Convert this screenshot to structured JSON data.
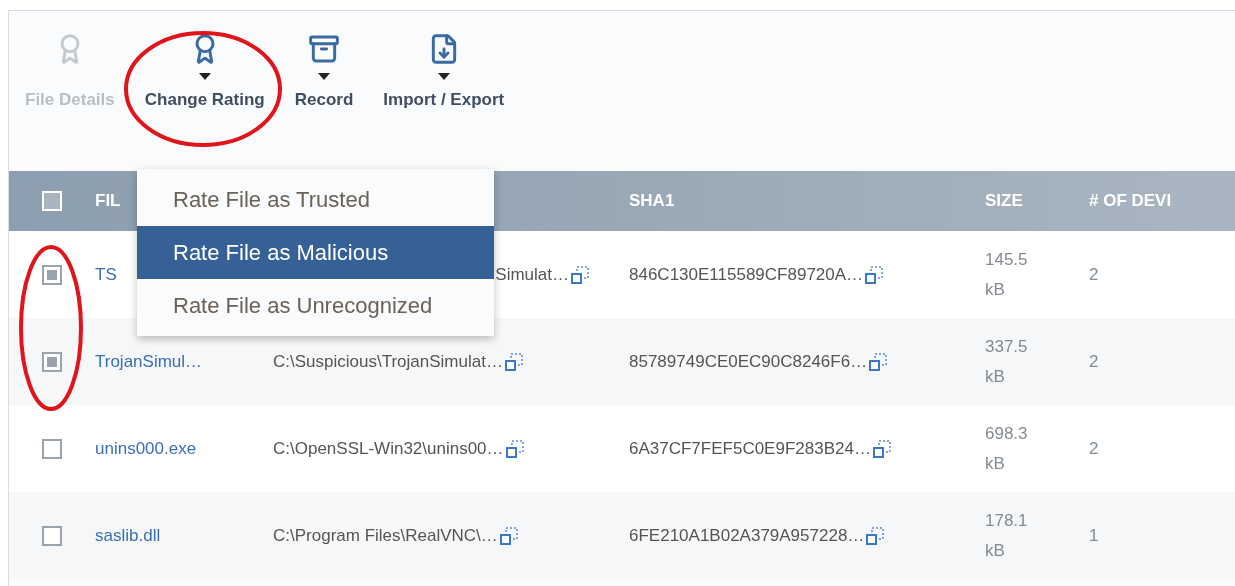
{
  "toolbar": [
    {
      "label": "File Details",
      "disabled": true,
      "has_menu": false
    },
    {
      "label": "Change Rating",
      "disabled": false,
      "has_menu": true
    },
    {
      "label": "Record",
      "disabled": false,
      "has_menu": true
    },
    {
      "label": "Import / Export",
      "disabled": false,
      "has_menu": true
    }
  ],
  "rating_menu": [
    {
      "label": "Rate File as Trusted",
      "selected": false
    },
    {
      "label": "Rate File as Malicious",
      "selected": true
    },
    {
      "label": "Rate File as Unrecognized",
      "selected": false
    }
  ],
  "table": {
    "select_all_checked": false,
    "columns": [
      "FIL",
      "SHA1",
      "SIZE",
      "# OF DEVI"
    ],
    "rows": [
      {
        "checked": true,
        "name": "TS",
        "path": "Simulat…",
        "sha1": "846C130E115589CF89720A…",
        "size": "145.5 kB",
        "devices": "2"
      },
      {
        "checked": true,
        "name": "TrojanSimul…",
        "path": "C:\\Suspicious\\TrojanSimulat…",
        "sha1": "85789749CE0EC90C8246F6…",
        "size": "337.5 kB",
        "devices": "2"
      },
      {
        "checked": false,
        "name": "unins000.exe",
        "path": "C:\\OpenSSL-Win32\\unins00…",
        "sha1": "6A37CF7FEF5C0E9F283B24…",
        "size": "698.3 kB",
        "devices": "2"
      },
      {
        "checked": false,
        "name": "saslib.dll",
        "path": "C:\\Program Files\\RealVNC\\…",
        "sha1": "6FE210A1B02A379A957228…",
        "size": "178.1 kB",
        "devices": "1"
      }
    ]
  }
}
